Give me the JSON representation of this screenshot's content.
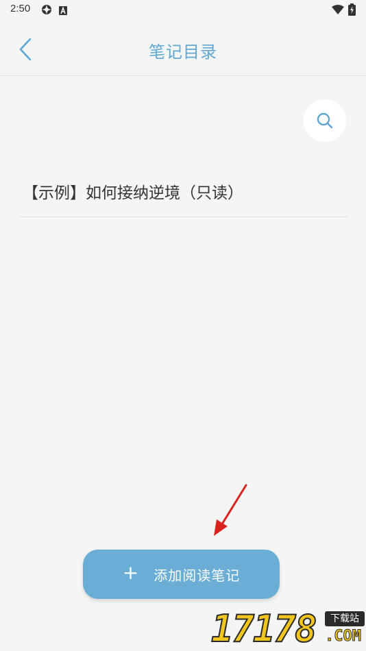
{
  "status_bar": {
    "time": "2:50",
    "icons": [
      "gear-icon",
      "a-badge-icon",
      "wifi-icon",
      "battery-charging-icon"
    ]
  },
  "header": {
    "title": "笔记目录",
    "back_icon": "chevron-left-icon"
  },
  "search": {
    "icon": "search-icon"
  },
  "notes": [
    {
      "title": "【示例】如何接纳逆境（只读）"
    }
  ],
  "add_button": {
    "plus": "+",
    "label": "添加阅读笔记"
  },
  "watermark": {
    "digits": "17178",
    "badge": "下载站",
    "com": ".COM"
  },
  "colors": {
    "accent": "#5fa8d3",
    "button_bg": "#6aaed6",
    "background": "#f4f5f5",
    "annotation_arrow": "#d9231c"
  }
}
